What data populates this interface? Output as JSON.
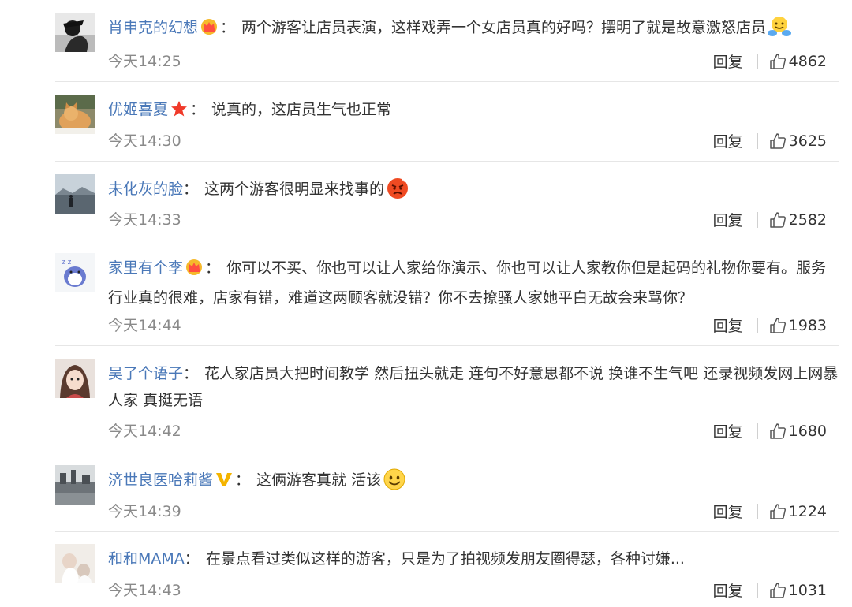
{
  "comments": [
    {
      "name": "肖申克的幻想",
      "badge": "crown-badge-icon",
      "text": "两个游客让店员表演，这样戏弄一个女店员真的好吗？摆明了就是故意激怒店员",
      "emoji": "hug-emoji-icon",
      "time": "今天14:25",
      "reply_label": "回复",
      "likes": "4862"
    },
    {
      "name": "优姬喜夏",
      "badge": "star-badge-icon",
      "text": "说真的，这店员生气也正常",
      "emoji": "",
      "time": "今天14:30",
      "reply_label": "回复",
      "likes": "3625"
    },
    {
      "name": "未化灰的脸",
      "badge": "",
      "text": "这两个游客很明显来找事的",
      "emoji": "angry-emoji-icon",
      "time": "今天14:33",
      "reply_label": "回复",
      "likes": "2582"
    },
    {
      "name": "家里有个李",
      "badge": "crown-badge-icon",
      "text": "你可以不买、你也可以让人家给你演示、你也可以让人家教你但是起码的礼物你要有。服务行业真的很难，店家有错，难道这两顾客就没错？你不去撩骚人家她平白无故会来骂你？",
      "emoji": "",
      "time": "今天14:44",
      "reply_label": "回复",
      "likes": "1983"
    },
    {
      "name": "吴了个语子",
      "badge": "",
      "text": "花人家店员大把时间教学 然后扭头就走 连句不好意思都不说 换谁不生气吧 还录视频发网上网暴人家 真挺无语",
      "emoji": "",
      "time": "今天14:42",
      "reply_label": "回复",
      "likes": "1680"
    },
    {
      "name": "济世良医哈莉酱",
      "badge": "v-badge-icon",
      "text": "这俩游客真就 活该",
      "emoji": "smile-emoji-icon",
      "time": "今天14:39",
      "reply_label": "回复",
      "likes": "1224"
    },
    {
      "name": "和和MAMA",
      "badge": "",
      "text": "在景点看过类似这样的游客，只是为了拍视频发朋友圈得瑟，各种讨嫌...",
      "emoji": "",
      "time": "今天14:43",
      "reply_label": "回复",
      "likes": "1031"
    }
  ],
  "colors": {
    "name": "#4a78b8",
    "time": "#8a8a8a",
    "divider": "#e6e6e6"
  }
}
